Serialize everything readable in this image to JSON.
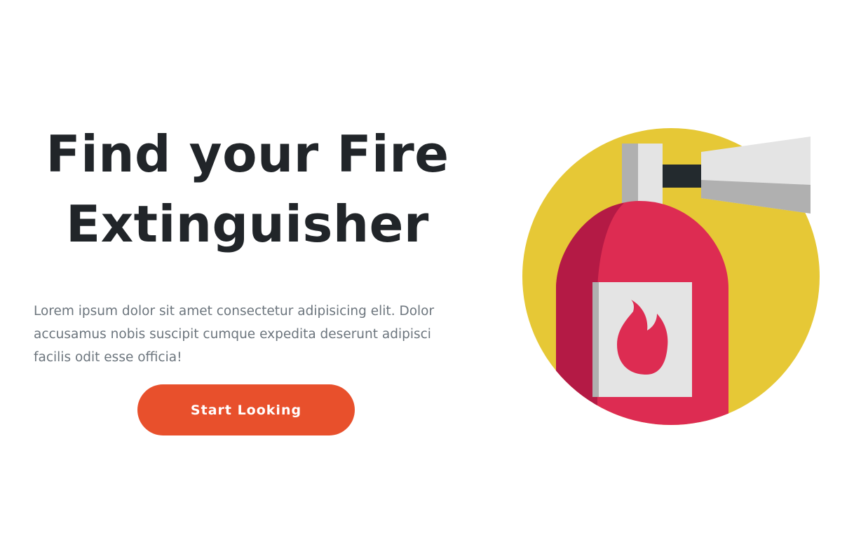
{
  "hero": {
    "title": "Find your Fire Extinguisher",
    "description": "Lorem ipsum dolor sit amet consectetur adipisicing elit. Dolor accusamus nobis suscipit cumque expedita deserunt adipisci facilis odit esse officia!",
    "cta_label": "Start Looking"
  },
  "illustration": {
    "icon": "fire-extinguisher-icon",
    "colors": {
      "circle": "#e6c836",
      "body": "#dd2c52",
      "body_shadow": "#b41a45",
      "label": "#e4e4e4",
      "label_shadow": "#b0b0b0",
      "flame": "#dd2c52",
      "hose": "#232a2e",
      "nozzle": "#e4e4e4",
      "nozzle_shadow": "#b0b0b0"
    }
  },
  "theme": {
    "cta_color": "#e8502c",
    "title_color": "#212529",
    "text_color": "#6c757d"
  }
}
